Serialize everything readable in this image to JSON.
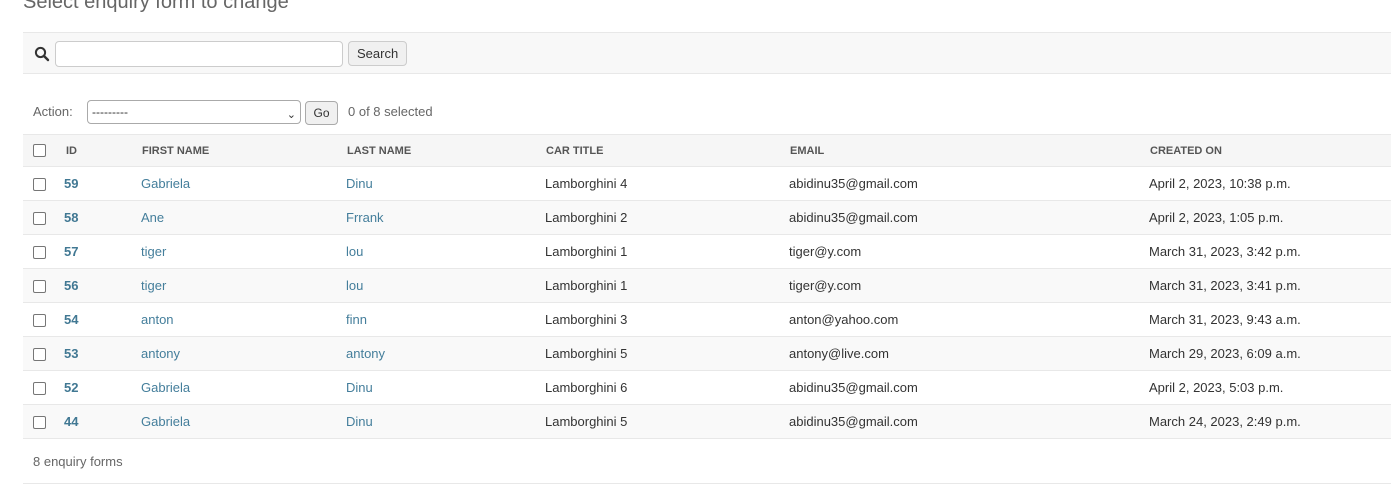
{
  "page": {
    "title": "Select enquiry form to change"
  },
  "search": {
    "placeholder": "",
    "value": "",
    "button_label": "Search"
  },
  "actions": {
    "label": "Action:",
    "selected_option": "---------",
    "go_label": "Go",
    "selection_status": "0 of 8 selected"
  },
  "table": {
    "headers": {
      "id": "ID",
      "first_name": "FIRST NAME",
      "last_name": "LAST NAME",
      "car_title": "CAR TITLE",
      "email": "EMAIL",
      "created_on": "CREATED ON"
    },
    "rows": [
      {
        "id": "59",
        "first_name": "Gabriela",
        "last_name": "Dinu",
        "car_title": "Lamborghini 4",
        "email": "abidinu35@gmail.com",
        "created_on": "April 2, 2023, 10:38 p.m."
      },
      {
        "id": "58",
        "first_name": "Ane",
        "last_name": "Frrank",
        "car_title": "Lamborghini 2",
        "email": "abidinu35@gmail.com",
        "created_on": "April 2, 2023, 1:05 p.m."
      },
      {
        "id": "57",
        "first_name": "tiger",
        "last_name": "lou",
        "car_title": "Lamborghini 1",
        "email": "tiger@y.com",
        "created_on": "March 31, 2023, 3:42 p.m."
      },
      {
        "id": "56",
        "first_name": "tiger",
        "last_name": "lou",
        "car_title": "Lamborghini 1",
        "email": "tiger@y.com",
        "created_on": "March 31, 2023, 3:41 p.m."
      },
      {
        "id": "54",
        "first_name": "anton",
        "last_name": "finn",
        "car_title": "Lamborghini 3",
        "email": "anton@yahoo.com",
        "created_on": "March 31, 2023, 9:43 a.m."
      },
      {
        "id": "53",
        "first_name": "antony",
        "last_name": "antony",
        "car_title": "Lamborghini 5",
        "email": "antony@live.com",
        "created_on": "March 29, 2023, 6:09 a.m."
      },
      {
        "id": "52",
        "first_name": "Gabriela",
        "last_name": "Dinu",
        "car_title": "Lamborghini 6",
        "email": "abidinu35@gmail.com",
        "created_on": "April 2, 2023, 5:03 p.m."
      },
      {
        "id": "44",
        "first_name": "Gabriela",
        "last_name": "Dinu",
        "car_title": "Lamborghini 5",
        "email": "abidinu35@gmail.com",
        "created_on": "March 24, 2023, 2:49 p.m."
      }
    ]
  },
  "footer": {
    "count_text": "8 enquiry forms"
  },
  "colors": {
    "link": "#447e9b",
    "header_bg": "#f6f6f6",
    "toolbar_bg": "#f8f8f8"
  },
  "icons": {
    "search": "search-icon",
    "dropdown": "chevron-down-icon"
  }
}
